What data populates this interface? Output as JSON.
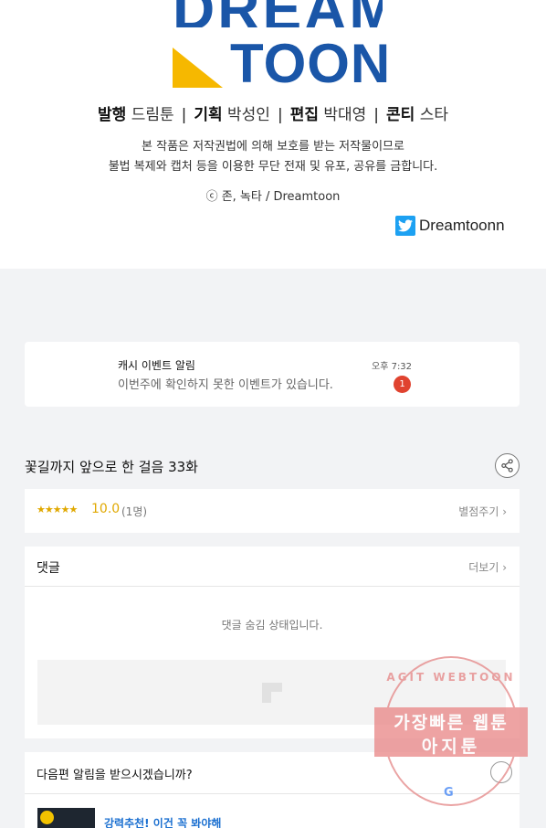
{
  "credit": {
    "logo_top": "DREAM",
    "logo_bottom": "TOON",
    "staff": [
      {
        "role": "발행",
        "name": "드림툰"
      },
      {
        "role": "기획",
        "name": "박성인"
      },
      {
        "role": "편집",
        "name": "박대영"
      },
      {
        "role": "콘티",
        "name": "스타"
      }
    ],
    "copyright_line1": "본 작품은 저작권법에 의해 보호를 받는 저작물이므로",
    "copyright_line2": "불법 복제와 캡처 등을 이용한 무단 전재 및 유포, 공유를 금합니다.",
    "author": "ⓒ 존, 녹타 / Dreamtoon",
    "twitter_handle": "Dreamtoonn"
  },
  "notification": {
    "title": "캐시 이벤트 알림",
    "body": "이번주에 확인하지 못한 이벤트가 있습니다.",
    "time": "오후 7:32",
    "badge": "1"
  },
  "episode": {
    "title": "꽃길까지 앞으로 한 걸음 33화"
  },
  "rating": {
    "stars": "★★★★★",
    "score": "10.0",
    "count": "(1명)",
    "link": "별점주기 ›"
  },
  "comments": {
    "title": "댓글",
    "more": "더보기 ›",
    "hidden_text": "댓글 숨김 상태입니다."
  },
  "alert": {
    "question": "다음편 알림을 받으시겠습니까?",
    "recommend": "강력추천! 이건 꼭 봐야해"
  },
  "watermark": {
    "arc_text": "AGIT WEBTOON",
    "line1": "가장빠른 웹툰",
    "line2": "아지툰"
  },
  "colors": {
    "brand_blue": "#1a56a8",
    "brand_yellow": "#f6b800",
    "star": "#e0a800",
    "badge": "#e0432f",
    "twitter": "#1da1f2"
  }
}
